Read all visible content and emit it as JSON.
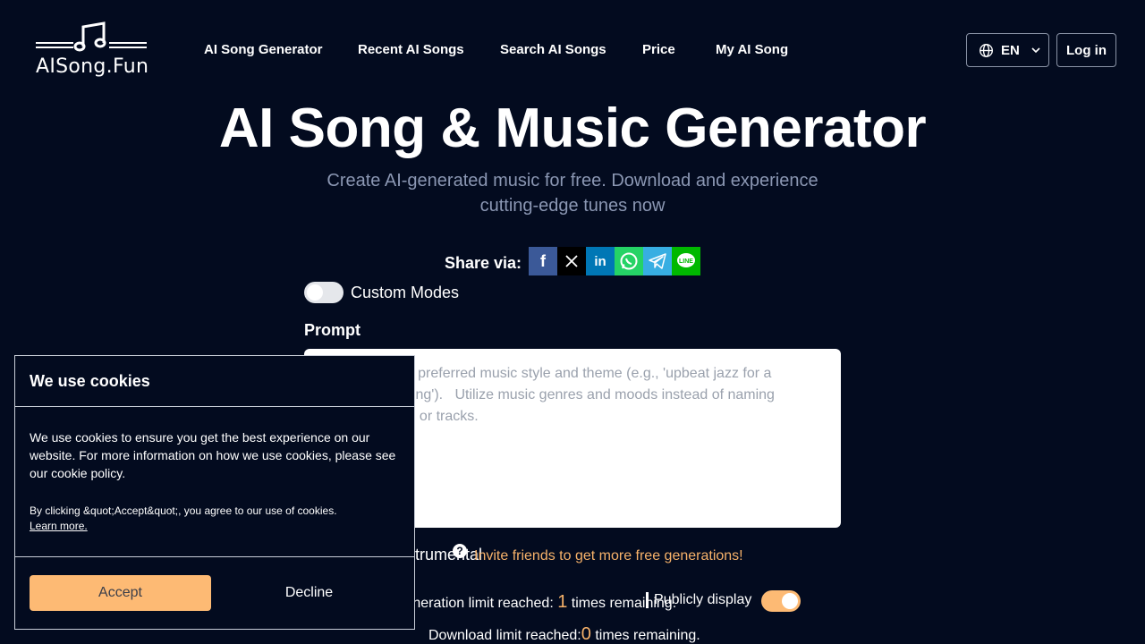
{
  "header": {
    "logo_text": "AISong.Fun",
    "nav": [
      "AI Song Generator",
      "Recent AI Songs",
      "Search AI Songs",
      "Price",
      "My AI Song"
    ],
    "lang": "EN",
    "login": "Log in"
  },
  "hero": {
    "title": "AI Song & Music Generator",
    "subtitle": "Create AI-generated music for free. Download and experience cutting-edge tunes now"
  },
  "share": {
    "label": "Share via:",
    "icons": [
      {
        "name": "facebook-icon",
        "color": "#3b5998"
      },
      {
        "name": "x-icon",
        "color": "#000000"
      },
      {
        "name": "linkedin-icon",
        "color": "#0077b5"
      },
      {
        "name": "whatsapp-icon",
        "color": "#25d366"
      },
      {
        "name": "telegram-icon",
        "color": "#37aee2"
      },
      {
        "name": "line-icon",
        "color": "#00b800"
      }
    ]
  },
  "form": {
    "custom_modes_label": "Custom Modes",
    "custom_modes_on": false,
    "prompt_label": "Prompt",
    "prompt_placeholder": "Describe your preferred music style and theme (e.g., 'upbeat jazz for a summer evening').   Utilize music genres and moods instead of naming specific artists or tracks.",
    "instrumental_label": "Instrumental",
    "invite_text": "Invite friends to get more free generations!",
    "gen_limit_prefix": "Generation limit reached: ",
    "gen_limit_num": "1",
    "gen_limit_suffix": " times remaining.",
    "public_label": "Publicly display",
    "public_on": true,
    "dl_limit_prefix": "Download limit reached:",
    "dl_limit_num": "0",
    "dl_limit_suffix": " times remaining."
  },
  "cookie": {
    "title": "We use cookies",
    "body": "We use cookies to ensure you get the best experience on our website. For more information on how we use cookies, please see our cookie policy.",
    "small": "By clicking &quot;Accept&quot;, you agree to our use of cookies.",
    "learn_more": "Learn more.",
    "accept": "Accept",
    "decline": "Decline"
  },
  "colors": {
    "background": "#030b1f",
    "accent": "#fdba74",
    "highlight_text": "#f7b26a"
  }
}
